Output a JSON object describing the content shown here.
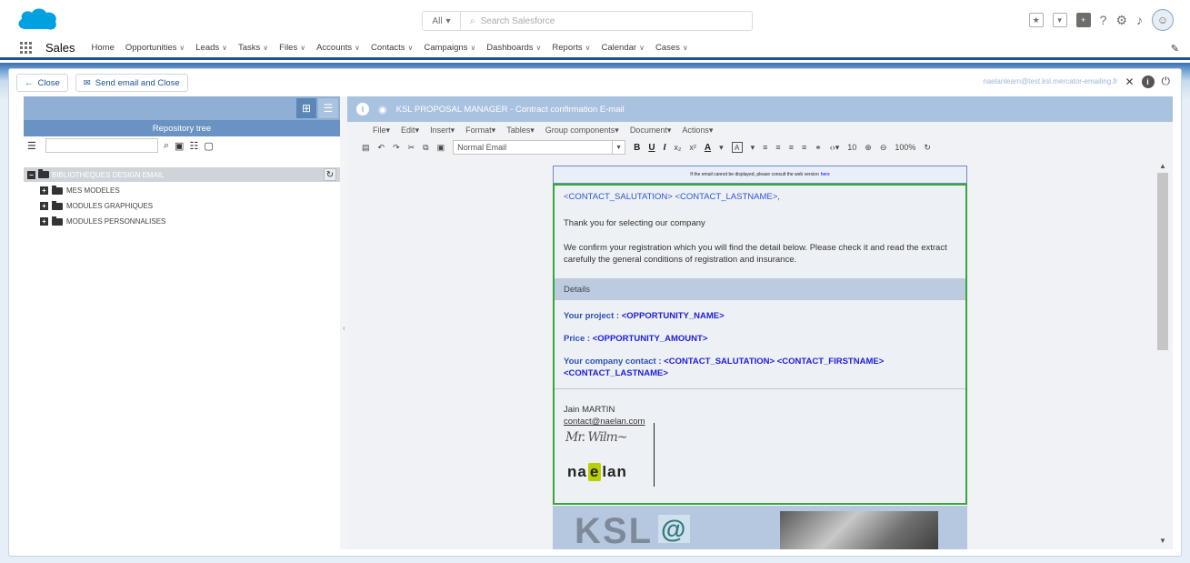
{
  "header": {
    "search_scope": "All",
    "search_placeholder": "Search Salesforce"
  },
  "nav": {
    "app_name": "Sales",
    "items": [
      {
        "label": "Home",
        "chevron": false
      },
      {
        "label": "Opportunities",
        "chevron": true
      },
      {
        "label": "Leads",
        "chevron": true
      },
      {
        "label": "Tasks",
        "chevron": true
      },
      {
        "label": "Files",
        "chevron": true
      },
      {
        "label": "Accounts",
        "chevron": true
      },
      {
        "label": "Contacts",
        "chevron": true
      },
      {
        "label": "Campaigns",
        "chevron": true
      },
      {
        "label": "Dashboards",
        "chevron": true
      },
      {
        "label": "Reports",
        "chevron": true
      },
      {
        "label": "Calendar",
        "chevron": true
      },
      {
        "label": "Cases",
        "chevron": true
      }
    ]
  },
  "toolbar": {
    "close_label": "Close",
    "send_label": "Send email and Close",
    "user_email": "naelanlearn@test.ksl.mercator-emailing.fr"
  },
  "left_panel": {
    "title": "Repository tree",
    "tree_root": "BIBLIOTHEQUES DESIGN EMAIL",
    "tree_items": [
      "MES MODELES",
      "MODULES GRAPHIQUES",
      "MODULES PERSONNALISES"
    ]
  },
  "editor": {
    "title": "KSL PROPOSAL MANAGER - Contract confirmation E-mail",
    "menus": [
      "File",
      "Edit",
      "Insert",
      "Format",
      "Tables",
      "Group components",
      "Document",
      "Actions"
    ],
    "format_select": "Normal Email",
    "font_size": "10",
    "zoom": "100%"
  },
  "email": {
    "top_notice": "If the email cannot be displayed, please consult the web version",
    "top_link": "here",
    "salutation": "<CONTACT_SALUTATION> <CONTACT_LASTNAME>,",
    "thanks": "Thank you for selecting our company",
    "confirm": "We confirm your registration which you will find the detail below. Please check it and read the extract carefully the general conditions of registration and insurance.",
    "details_title": "Details",
    "project_label": "Your project : ",
    "project_value": "<OPPORTUNITY_NAME>",
    "price_label": "Price : ",
    "price_value": "<OPPORTUNITY_AMOUNT>",
    "contact_label": "Your company contact : ",
    "contact_value": "<CONTACT_SALUTATION> <CONTACT_FIRSTNAME> <CONTACT_LASTNAME>",
    "sig_name": "Jain MARTIN",
    "sig_email": "contact@naelan.com",
    "logo_text": "naelan",
    "banner_text": "KSL"
  }
}
